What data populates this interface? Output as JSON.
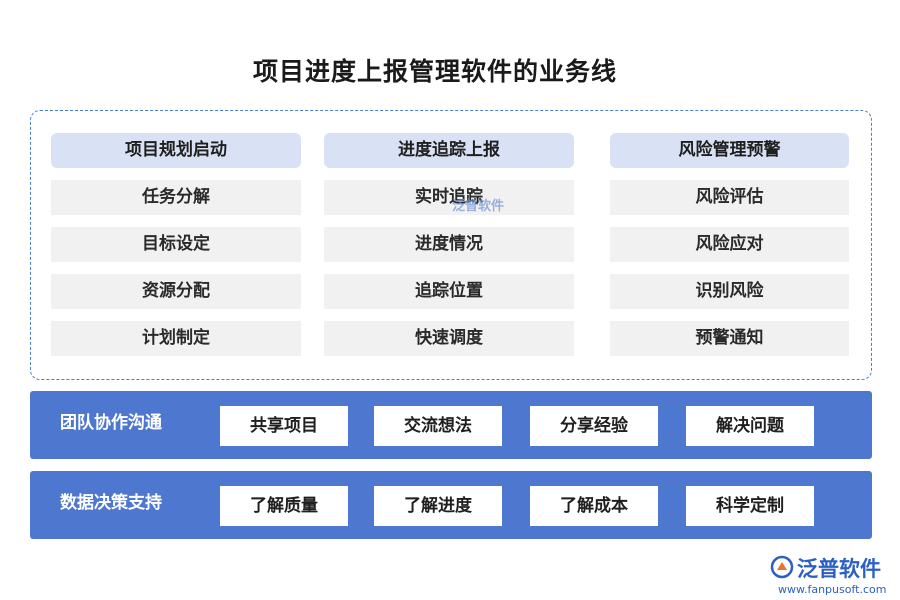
{
  "title": "项目进度上报管理软件的业务线",
  "columns": [
    {
      "header": "项目规划启动",
      "items": [
        "任务分解",
        "目标设定",
        "资源分配",
        "计划制定"
      ]
    },
    {
      "header": "进度追踪上报",
      "items": [
        "实时追踪",
        "进度情况",
        "追踪位置",
        "快速调度"
      ]
    },
    {
      "header": "风险管理预警",
      "items": [
        "风险评估",
        "风险应对",
        "识别风险",
        "预警通知"
      ]
    }
  ],
  "bands": [
    {
      "label": "团队协作沟通",
      "chips": [
        "共享项目",
        "交流想法",
        "分享经验",
        "解决问题"
      ]
    },
    {
      "label": "数据决策支持",
      "chips": [
        "了解质量",
        "了解进度",
        "了解成本",
        "科学定制"
      ]
    }
  ],
  "watermark": "泛普软件",
  "brand": {
    "name": "泛普软件",
    "url": "www.fanpusoft.com"
  },
  "colors": {
    "accent": "#4e78cf",
    "header_fill": "#d9e2f5",
    "item_fill": "#f1f1f1",
    "border": "#4a7fd0"
  }
}
